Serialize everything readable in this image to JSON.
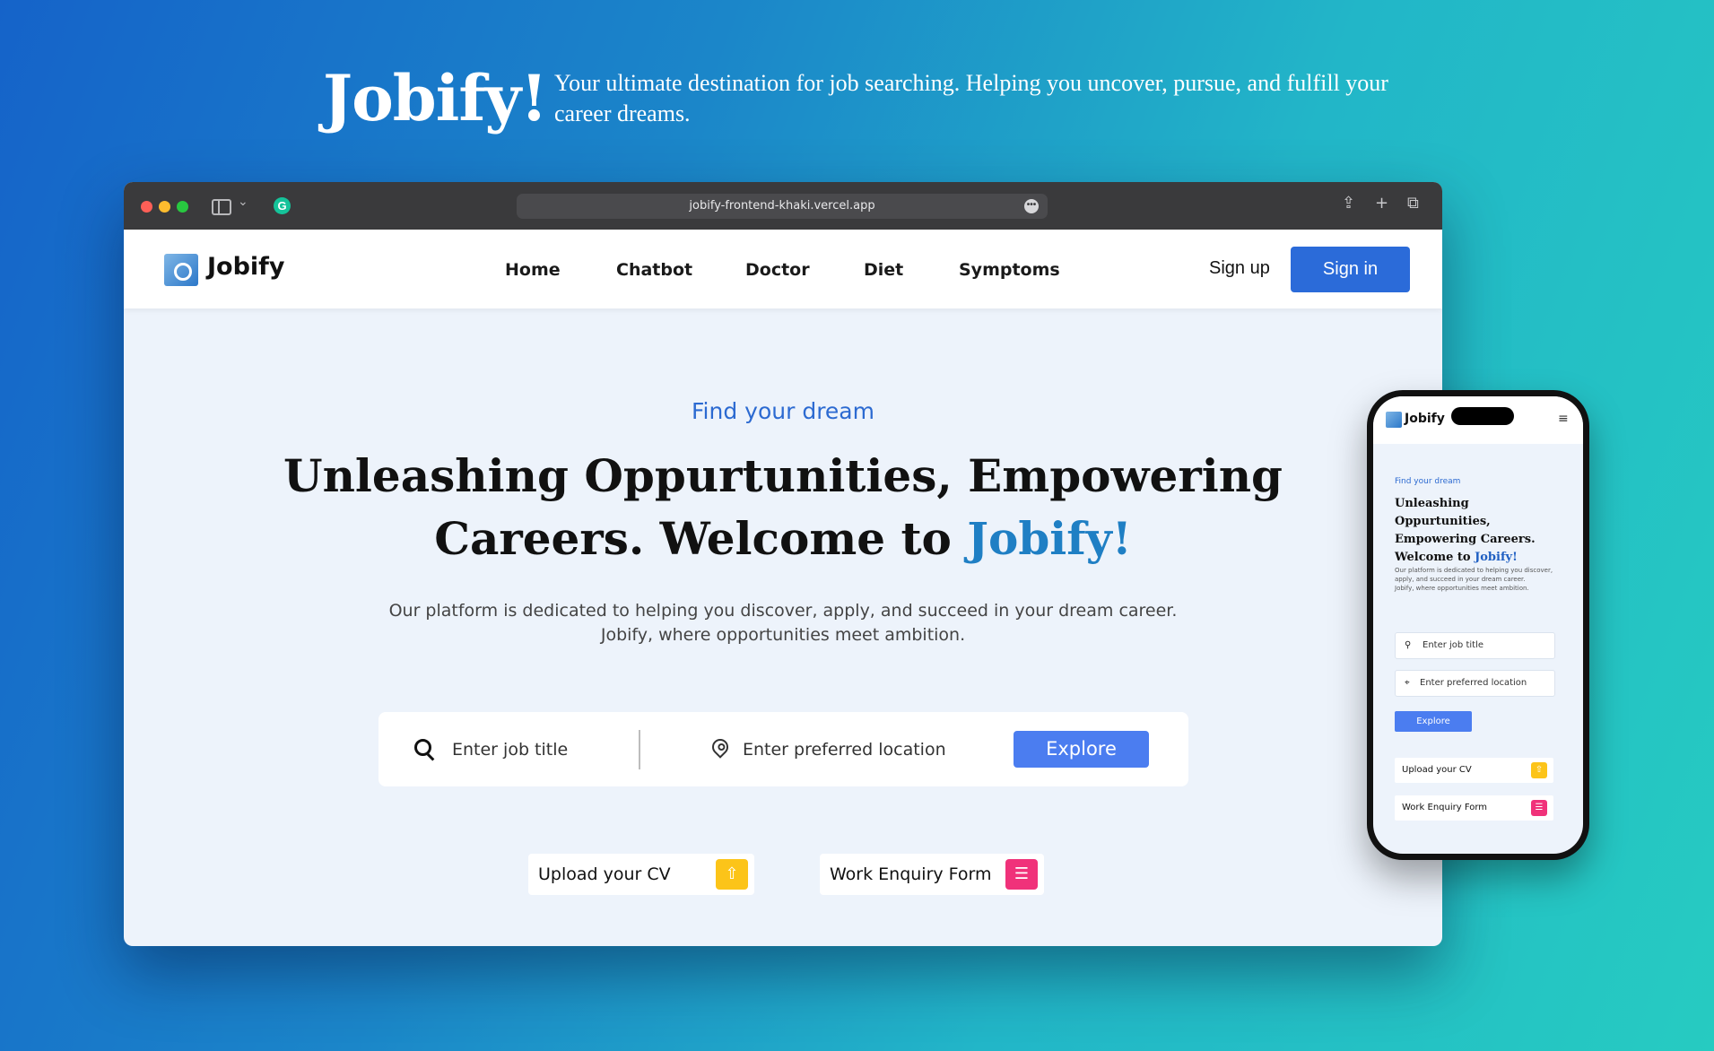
{
  "promo": {
    "title": "Jobify!",
    "tagline": "Your ultimate destination for job searching. Helping you uncover, pursue, and fulfill your career dreams."
  },
  "browser": {
    "url": "jobify-frontend-khaki.vercel.app",
    "more_glyph": "•••",
    "share_glyph": "⇪",
    "new_tab_glyph": "+",
    "tabs_glyph": "⧉",
    "chevron_glyph": "⌄",
    "grammarly_glyph": "G"
  },
  "nav": {
    "logo_text": "Jobify",
    "links": [
      "Home",
      "Chatbot",
      "Doctor",
      "Diet",
      "Symptoms"
    ],
    "signup": "Sign up",
    "signin": "Sign in"
  },
  "hero": {
    "eyebrow": "Find your dream",
    "title_main": "Unleashing Oppurtunities, Empowering Careers. Welcome to ",
    "title_accent": "Jobify!",
    "desc_line1": "Our platform is dedicated to helping you discover, apply, and succeed in your dream career.",
    "desc_line2": "Jobify, where opportunities meet ambition."
  },
  "search": {
    "job_placeholder": "Enter job title",
    "location_placeholder": "Enter preferred location",
    "explore": "Explore"
  },
  "actions": {
    "upload_cv": "Upload your CV",
    "upload_glyph": "⇧",
    "work_enquiry": "Work Enquiry Form",
    "form_glyph": "☰"
  },
  "mobile": {
    "logo_text": "Jobify",
    "menu_glyph": "≡",
    "eyebrow": "Find your dream",
    "title_main": "Unleashing Oppurtunities, Empowering Careers. Welcome to ",
    "title_accent": "Jobify!",
    "desc_line1": "Our platform is dedicated to helping you discover, apply, and succeed in your dream career.",
    "desc_line2": "Jobify, where opportunities meet ambition.",
    "job_placeholder": "Enter job title",
    "location_placeholder": "Enter preferred location",
    "search_glyph": "⚲",
    "pin_glyph": "⌖",
    "explore": "Explore",
    "upload_cv": "Upload your CV",
    "work_enquiry": "Work Enquiry Form"
  },
  "colors": {
    "primary_button": "#2b6bd9",
    "explore_button": "#4b7df0",
    "accent_text": "#2c6ad1",
    "upload_badge": "#fcc419",
    "form_badge": "#f0327a"
  }
}
